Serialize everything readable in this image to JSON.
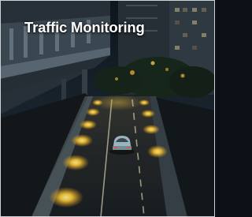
{
  "card": {
    "title": "Traffic Monitoring"
  },
  "photo": {
    "subject": "night-highway-with-car",
    "colors": {
      "sky": "#121c26",
      "road": "#22282b",
      "lamp": "#f4b62a",
      "glow": "#ffcf4a",
      "building": "#2c3640"
    }
  }
}
